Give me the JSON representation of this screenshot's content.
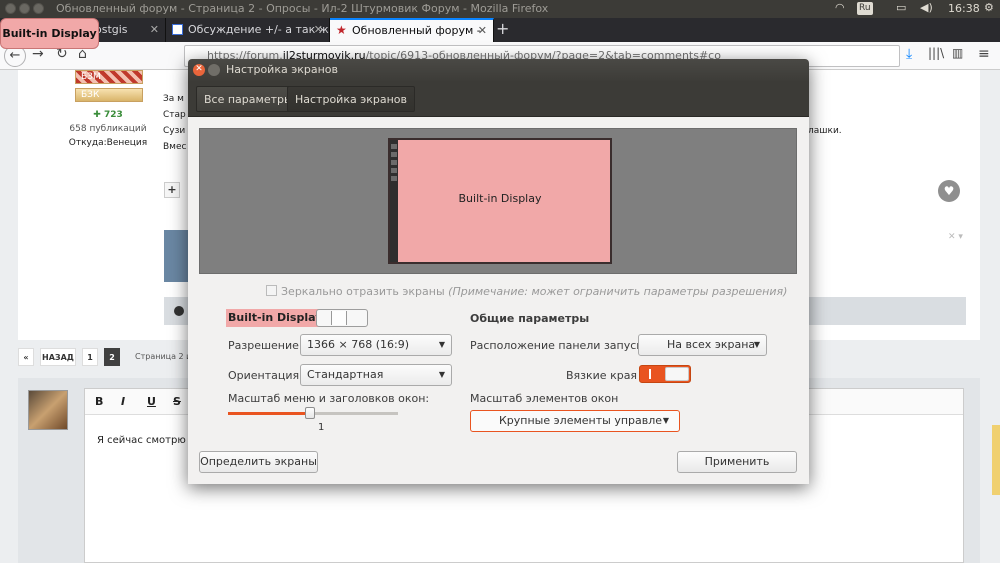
{
  "panel": {
    "title": "Обновленный форум - Страница 2 - Опросы - Ил-2 Штурмовик Форум - Mozilla Firefox",
    "keyboard_layout": "Ru",
    "clock": "16:38"
  },
  "tooltip": {
    "text": "Built-in Display"
  },
  "browser": {
    "tabs": [
      {
        "label": "postgis",
        "active": false
      },
      {
        "label": "Обсуждение +/- а так ж",
        "active": false
      },
      {
        "label": "Обновленный форум -",
        "active": true
      }
    ],
    "new_tab": "+",
    "url_prefix": "https://forum.",
    "url_host": "il2sturmovik.ru",
    "url_path": "/topic/6913-обновленный-форум/?page=2&tab=comments#co"
  },
  "post": {
    "badges": [
      "БЗМ",
      "БЗК"
    ],
    "reputation": "723",
    "publications": "658 публикаций",
    "location": "Откуда:Венеция",
    "text_lines": [
      "За м",
      "Стар",
      "Сузи",
      "Вмес"
    ],
    "text_right": "лашки.",
    "plus": "+"
  },
  "pagination": {
    "prev": "«",
    "back_label": "НАЗАД",
    "pages": [
      "1",
      "2"
    ],
    "current": "2",
    "info": "Страница 2 и"
  },
  "editor": {
    "tools": [
      "B",
      "I",
      "U",
      "S"
    ],
    "text": "Я сейчас смотрю с"
  },
  "dialog": {
    "title": "Настройка экранов",
    "breadcrumbs": [
      "Все параметры",
      "Настройка экранов"
    ],
    "monitor_label": "Built-in Display",
    "mirror_label": "Зеркально отразить экраны",
    "mirror_note": "(Примечание: может ограничить параметры разрешения)",
    "display_name": "Built-in Display",
    "display_on": false,
    "resolution_label": "Разрешение",
    "resolution_value": "1366 × 768 (16:9)",
    "orientation_label": "Ориентация",
    "orientation_value": "Стандартная",
    "scale_label": "Масштаб меню и заголовков окон:",
    "scale_value": "1",
    "scale_fraction": 0.48,
    "common_heading": "Общие параметры",
    "launcher_label": "Расположение панели запуска",
    "launcher_value": "На всех экрана",
    "sticky_label": "Вязкие края",
    "sticky_on": true,
    "elements_scale_label": "Масштаб элементов окон",
    "elements_scale_value": "Крупные элементы управле",
    "detect_button": "Определить экраны",
    "apply_button": "Применить"
  },
  "colors": {
    "accent": "#e95420",
    "monitor": "#f1a8a8",
    "panel": "#3c3b37"
  }
}
